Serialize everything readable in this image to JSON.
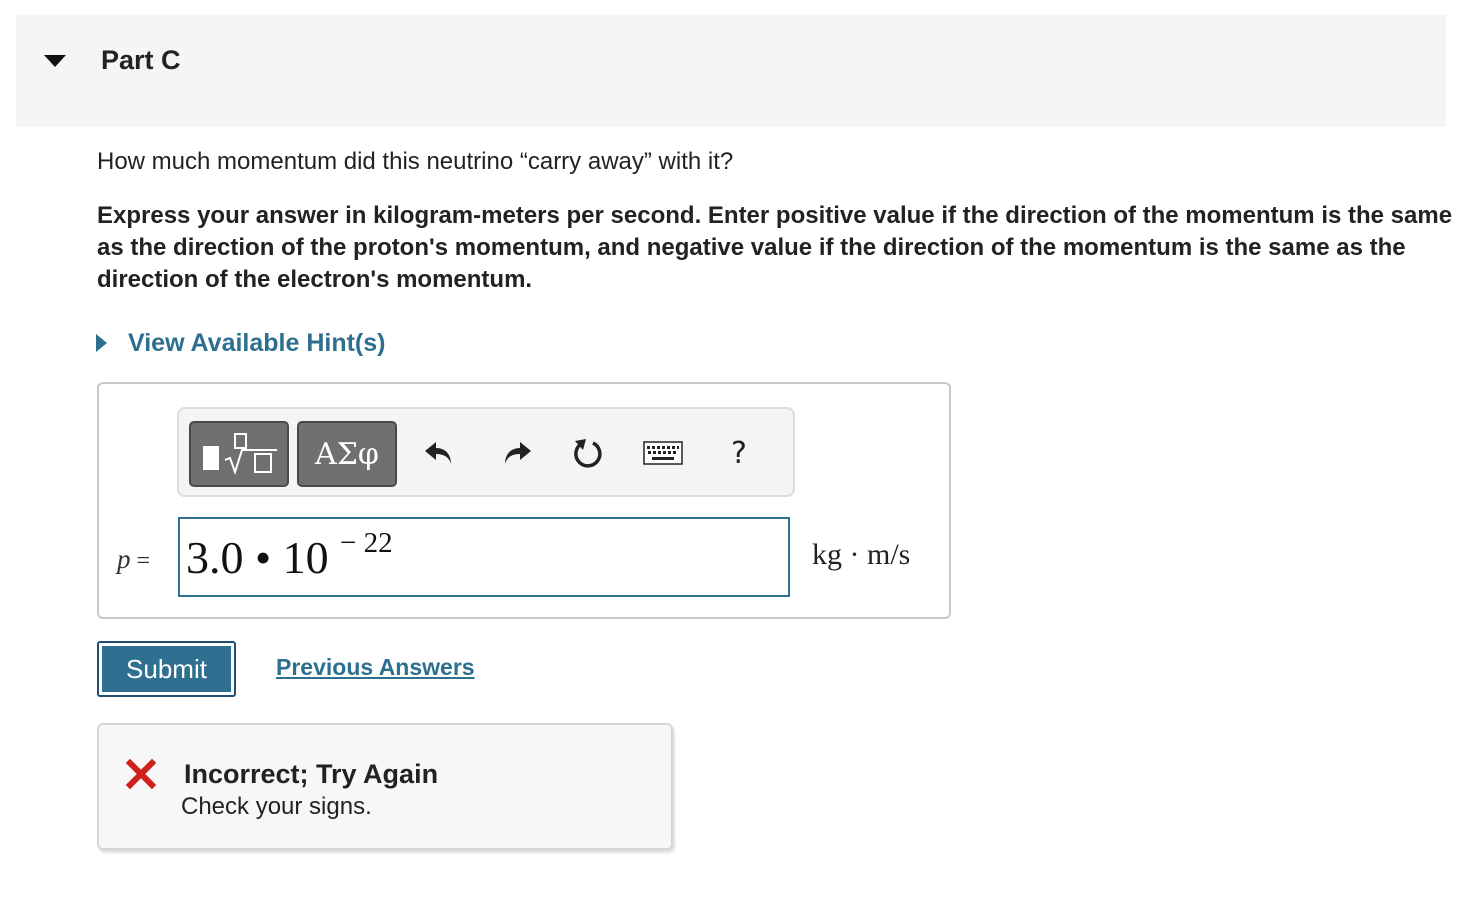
{
  "part": {
    "title": "Part C"
  },
  "question": "How much momentum did this neutrino “carry away” with it?",
  "instructions": "Express your answer in kilogram-meters per second. Enter positive value if the direction of the momentum is the same as the direction of the proton's momentum, and negative value if the direction of the momentum is the same as the direction of the electron's momentum.",
  "hints": {
    "label": "View Available Hint(s)"
  },
  "toolbar": {
    "template_icon": "fraction-sqrt-template-icon",
    "greek_label": "ΑΣφ",
    "undo_icon": "undo-icon",
    "redo_icon": "redo-icon",
    "reset_icon": "reset-icon",
    "keyboard_icon": "keyboard-icon",
    "help_label": "?"
  },
  "answer": {
    "variable": "p",
    "equals": "=",
    "base": "3.0 • 10",
    "exponent": "− 22",
    "units": "kg · m/s"
  },
  "actions": {
    "submit_label": "Submit",
    "previous_answers_label": "Previous Answers"
  },
  "feedback": {
    "icon": "incorrect-x-icon",
    "title": "Incorrect; Try Again",
    "message": "Check your signs."
  },
  "colors": {
    "accent": "#2f7090",
    "link": "#2d6f8e",
    "error": "#d0201b",
    "toolbar_button": "#707070",
    "header_bg": "#f5f5f5"
  }
}
